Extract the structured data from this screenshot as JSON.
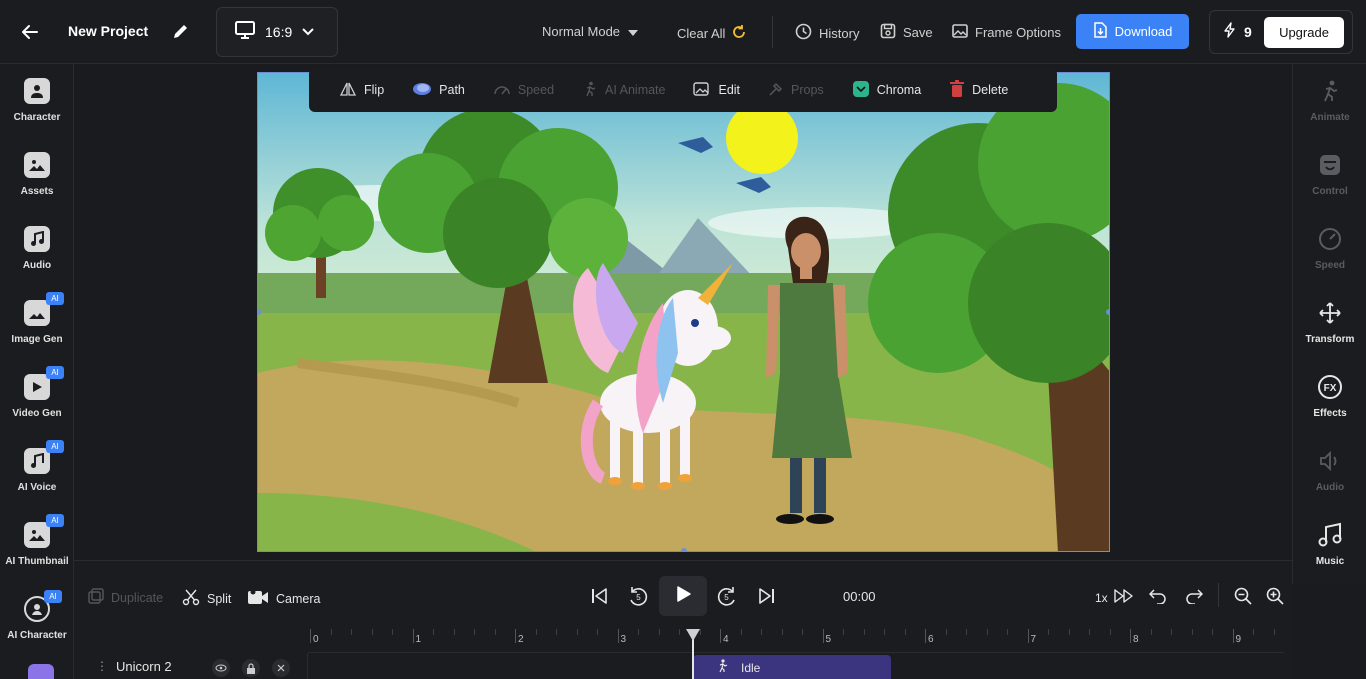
{
  "header": {
    "project_title": "New Project",
    "aspect_ratio": "16:9",
    "mode": "Normal Mode",
    "clear_all": "Clear All",
    "history": "History",
    "save": "Save",
    "frame_options": "Frame Options",
    "download": "Download",
    "credits": "9",
    "upgrade": "Upgrade"
  },
  "left_sidebar": {
    "items": [
      {
        "label": "Character",
        "ai": false
      },
      {
        "label": "Assets",
        "ai": false
      },
      {
        "label": "Audio",
        "ai": false
      },
      {
        "label": "Image Gen",
        "ai": true
      },
      {
        "label": "Video Gen",
        "ai": true
      },
      {
        "label": "AI Voice",
        "ai": true
      },
      {
        "label": "AI Thumbnail",
        "ai": true
      },
      {
        "label": "AI Character",
        "ai": true
      }
    ],
    "badge": "AI"
  },
  "right_sidebar": {
    "items": [
      {
        "label": "Animate",
        "enabled": false
      },
      {
        "label": "Control",
        "enabled": false
      },
      {
        "label": "Speed",
        "enabled": false
      },
      {
        "label": "Transform",
        "enabled": true
      },
      {
        "label": "Effects",
        "enabled": true
      },
      {
        "label": "Audio",
        "enabled": false
      },
      {
        "label": "Music",
        "enabled": true
      }
    ]
  },
  "context_toolbar": {
    "items": [
      {
        "label": "Flip",
        "enabled": true
      },
      {
        "label": "Path",
        "enabled": true
      },
      {
        "label": "Speed",
        "enabled": false
      },
      {
        "label": "AI Animate",
        "enabled": false
      },
      {
        "label": "Edit",
        "enabled": true
      },
      {
        "label": "Props",
        "enabled": false
      },
      {
        "label": "Chroma",
        "enabled": true
      },
      {
        "label": "Delete",
        "enabled": true
      }
    ]
  },
  "timeline": {
    "duplicate": "Duplicate",
    "split": "Split",
    "camera": "Camera",
    "skip_back_seconds": "5",
    "skip_forward_seconds": "5",
    "time": "00:00",
    "speed": "1x",
    "ruler_labels": [
      "0",
      "1",
      "2",
      "3",
      "4",
      "5",
      "6",
      "7",
      "8",
      "9"
    ],
    "track_name": "Unicorn 2",
    "clip_label": "Idle"
  },
  "colors": {
    "accent": "#3b82f6",
    "background": "#1a1b1e",
    "panel": "#1b1c1f",
    "clip": "#3b3580"
  }
}
